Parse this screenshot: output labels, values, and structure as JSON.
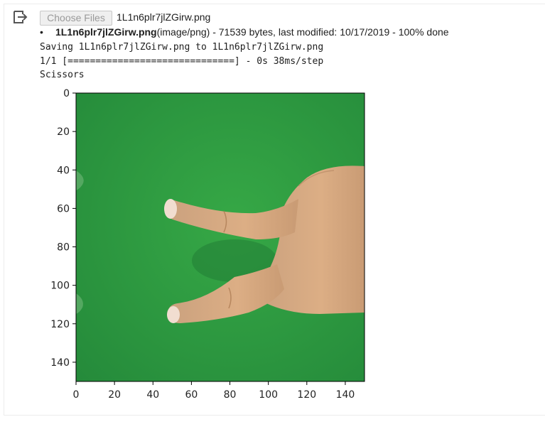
{
  "upload": {
    "choose_files_label": "Choose Files",
    "selected_file": "1L1n6plr7jlZGirw.png"
  },
  "file_list": [
    {
      "name": "1L1n6plr7jlZGirw.png",
      "details": "(image/png) - 71539 bytes, last modified: 10/17/2019 - 100% done"
    }
  ],
  "output_lines": [
    "Saving 1L1n6plr7jlZGirw.png to 1L1n6plr7jlZGirw.png",
    "1/1 [==============================] - 0s 38ms/step",
    "Scissors"
  ],
  "icons": {
    "output_icon": "output-redirect-icon"
  },
  "plot": {
    "x_ticks": [
      "0",
      "20",
      "40",
      "60",
      "80",
      "100",
      "120",
      "140"
    ],
    "y_ticks": [
      "0",
      "20",
      "40",
      "60",
      "80",
      "100",
      "120",
      "140"
    ],
    "x_range": [
      0,
      150
    ],
    "y_range": [
      0,
      150
    ],
    "image_subject": "hand making scissors gesture on green background",
    "colors": {
      "background_green": "#2f9e3c",
      "skin": "#d9a77a"
    }
  }
}
